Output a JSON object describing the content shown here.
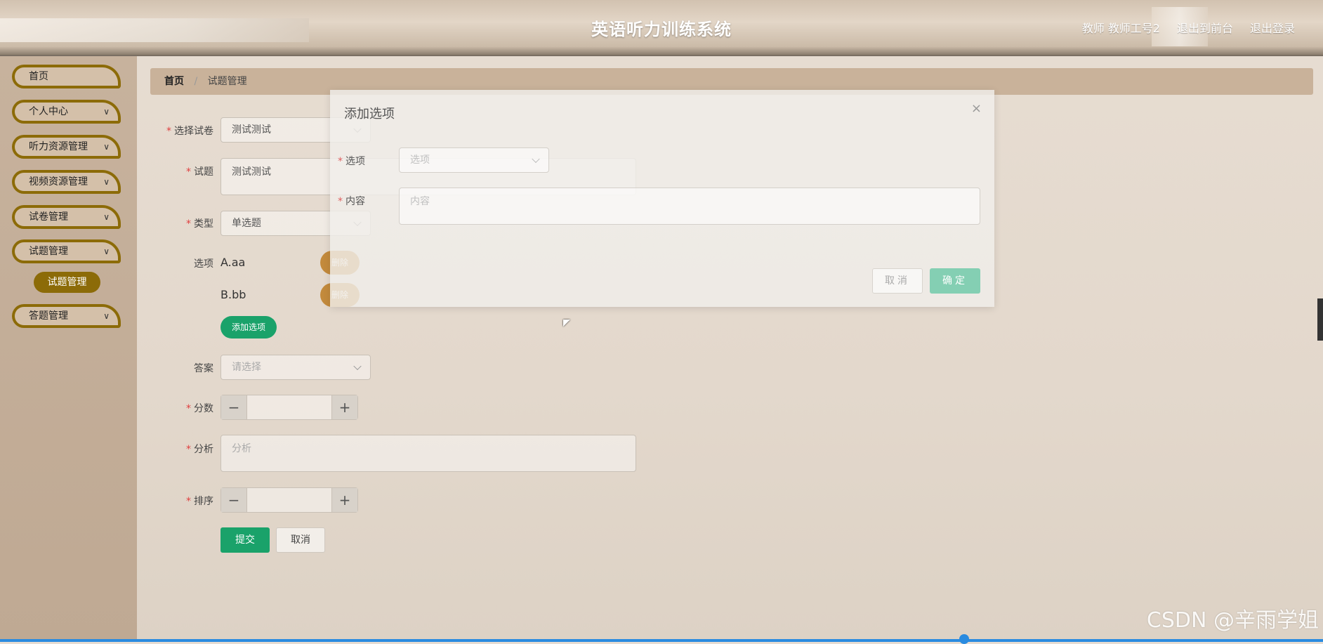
{
  "header": {
    "title": "英语听力训练系统",
    "user": "教师 教师工号2",
    "to_front": "退出到前台",
    "logout": "退出登录"
  },
  "sidebar": {
    "items": [
      {
        "label": "首页",
        "has_arrow": false
      },
      {
        "label": "个人中心",
        "has_arrow": true
      },
      {
        "label": "听力资源管理",
        "has_arrow": true
      },
      {
        "label": "视频资源管理",
        "has_arrow": true
      },
      {
        "label": "试卷管理",
        "has_arrow": true
      },
      {
        "label": "试题管理",
        "has_arrow": true
      },
      {
        "label": "答题管理",
        "has_arrow": true
      }
    ],
    "sub_item": "试题管理"
  },
  "breadcrumb": {
    "home": "首页",
    "sep": "/",
    "current": "试题管理"
  },
  "form": {
    "paper_label": "选择试卷",
    "paper_value": "测试测试",
    "question_label": "试题",
    "question_value": "测试测试",
    "type_label": "类型",
    "type_value": "单选题",
    "options_label": "选项",
    "options": [
      "A.aa",
      "B.bb"
    ],
    "delete_label": "删除",
    "add_option": "添加选项",
    "answer_label": "答案",
    "answer_placeholder": "请选择",
    "score_label": "分数",
    "analysis_label": "分析",
    "analysis_placeholder": "分析",
    "order_label": "排序",
    "minus": "−",
    "plus": "+",
    "submit": "提交",
    "cancel": "取消"
  },
  "dialog": {
    "title": "添加选项",
    "close": "×",
    "option_label": "选项",
    "option_placeholder": "选项",
    "content_label": "内容",
    "content_placeholder": "内容",
    "cancel": "取消",
    "ok": "确定"
  },
  "watermark": "CSDN @辛雨学姐",
  "colors": {
    "primary_green": "#1aa26a",
    "sidebar_accent": "#8c6b08",
    "delete_button": "#c38a3c"
  }
}
